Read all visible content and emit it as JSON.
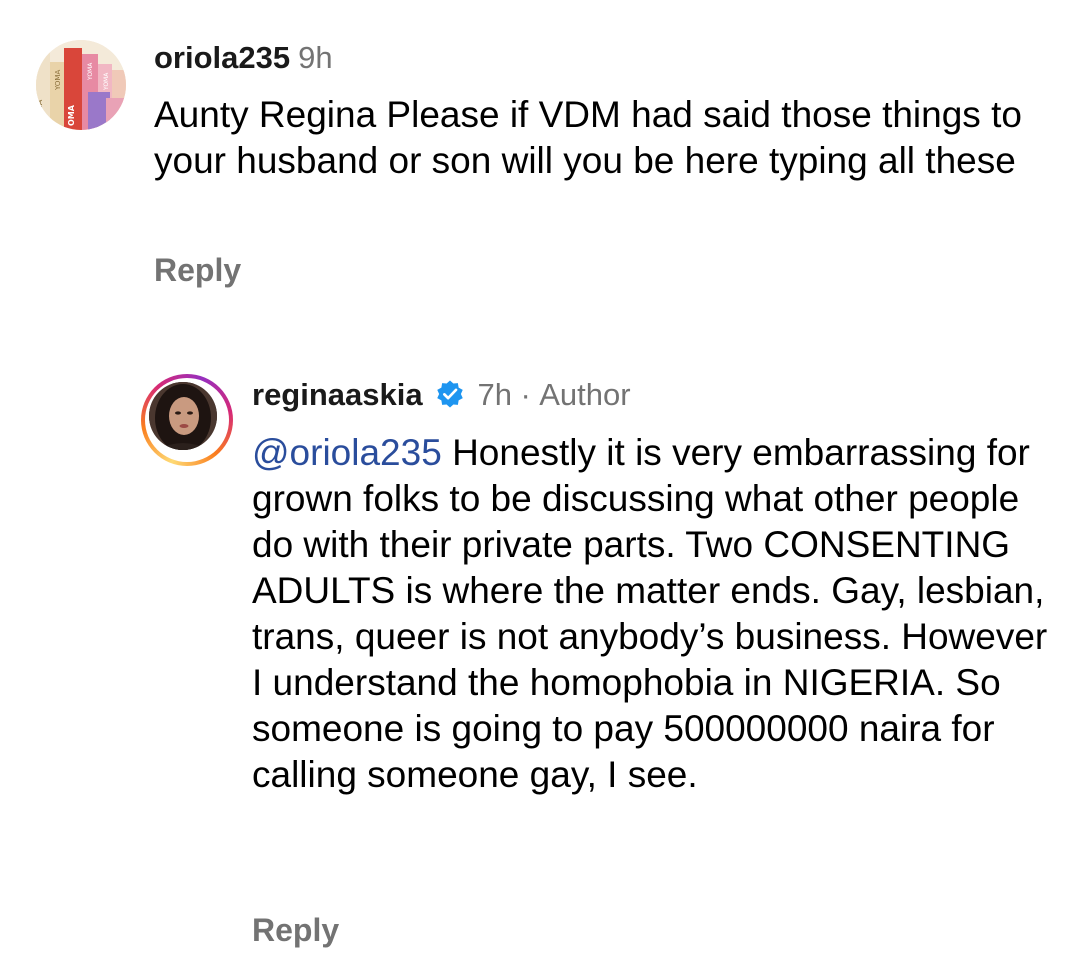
{
  "comments": [
    {
      "username": "oriola235",
      "time": "9h",
      "text": "Aunty Regina Please if VDM had said those things to your husband or son will you be here typing all these",
      "reply_label": "Reply",
      "avatar": "books-avatar",
      "avatar_spines": [
        "MA",
        "OMA",
        "YOMA",
        "YOMA",
        "YOMA"
      ]
    },
    {
      "username": "reginaaskia",
      "verified": true,
      "time": "7h",
      "separator": "·",
      "author_label": "Author",
      "mention": "@oriola235",
      "text": "Honestly it is very embarrassing for grown folks to be discussing what other people do with their private parts. Two CONSENTING ADULTS is where the matter ends. Gay, lesbian, trans, queer is not anybody’s business. However I understand the homophobia in NIGERIA. So someone is going to pay 500000000 naira for calling someone gay, I see.",
      "reply_label": "Reply",
      "avatar": "profile-photo-avatar"
    }
  ],
  "colors": {
    "text": "#000000",
    "secondary": "#737373",
    "mention": "#2a4d9c",
    "verified": "#1e95f0",
    "story_ring": [
      "#feda75",
      "#fa7e1e",
      "#d62976",
      "#962fbf"
    ]
  },
  "icons": {
    "verified": "verified-badge-icon"
  }
}
